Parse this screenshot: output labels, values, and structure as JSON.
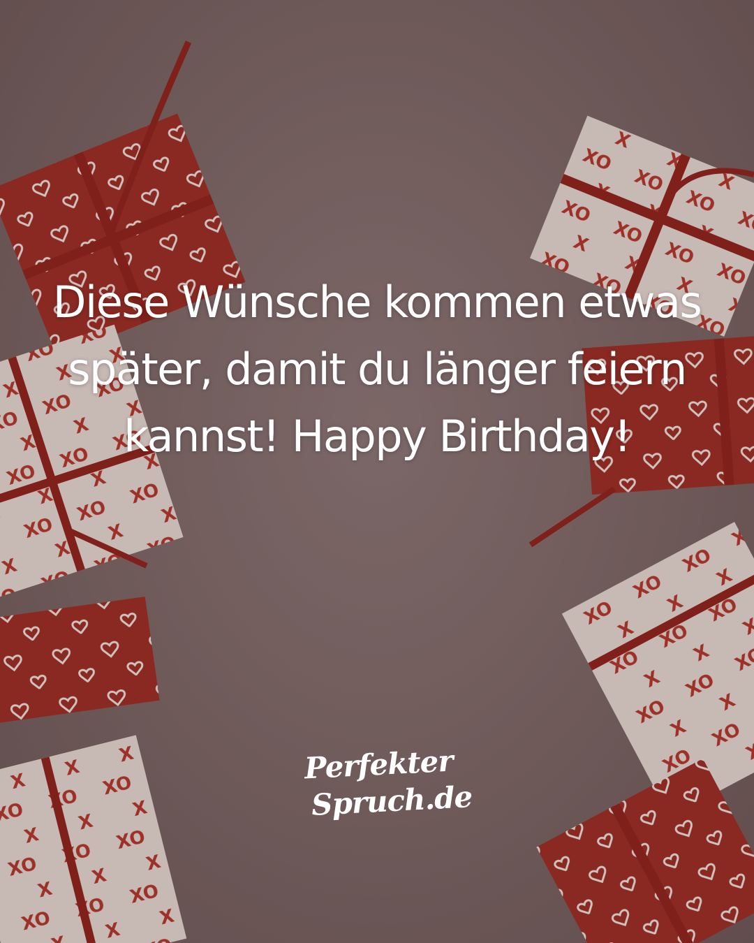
{
  "quote": {
    "line1": "Diese Wünsche kommen etwas",
    "line2": "später, damit du länger feiern",
    "line3": "kannst! Happy Birthday!"
  },
  "logo": {
    "line1": "Perfekter",
    "line2": "Spruch.de"
  },
  "colors": {
    "background": "#7d6868",
    "gift_red": "#9a2a22",
    "gift_white": "#e8dcd6",
    "ribbon": "#8e1f18",
    "text": "#ffffff"
  }
}
